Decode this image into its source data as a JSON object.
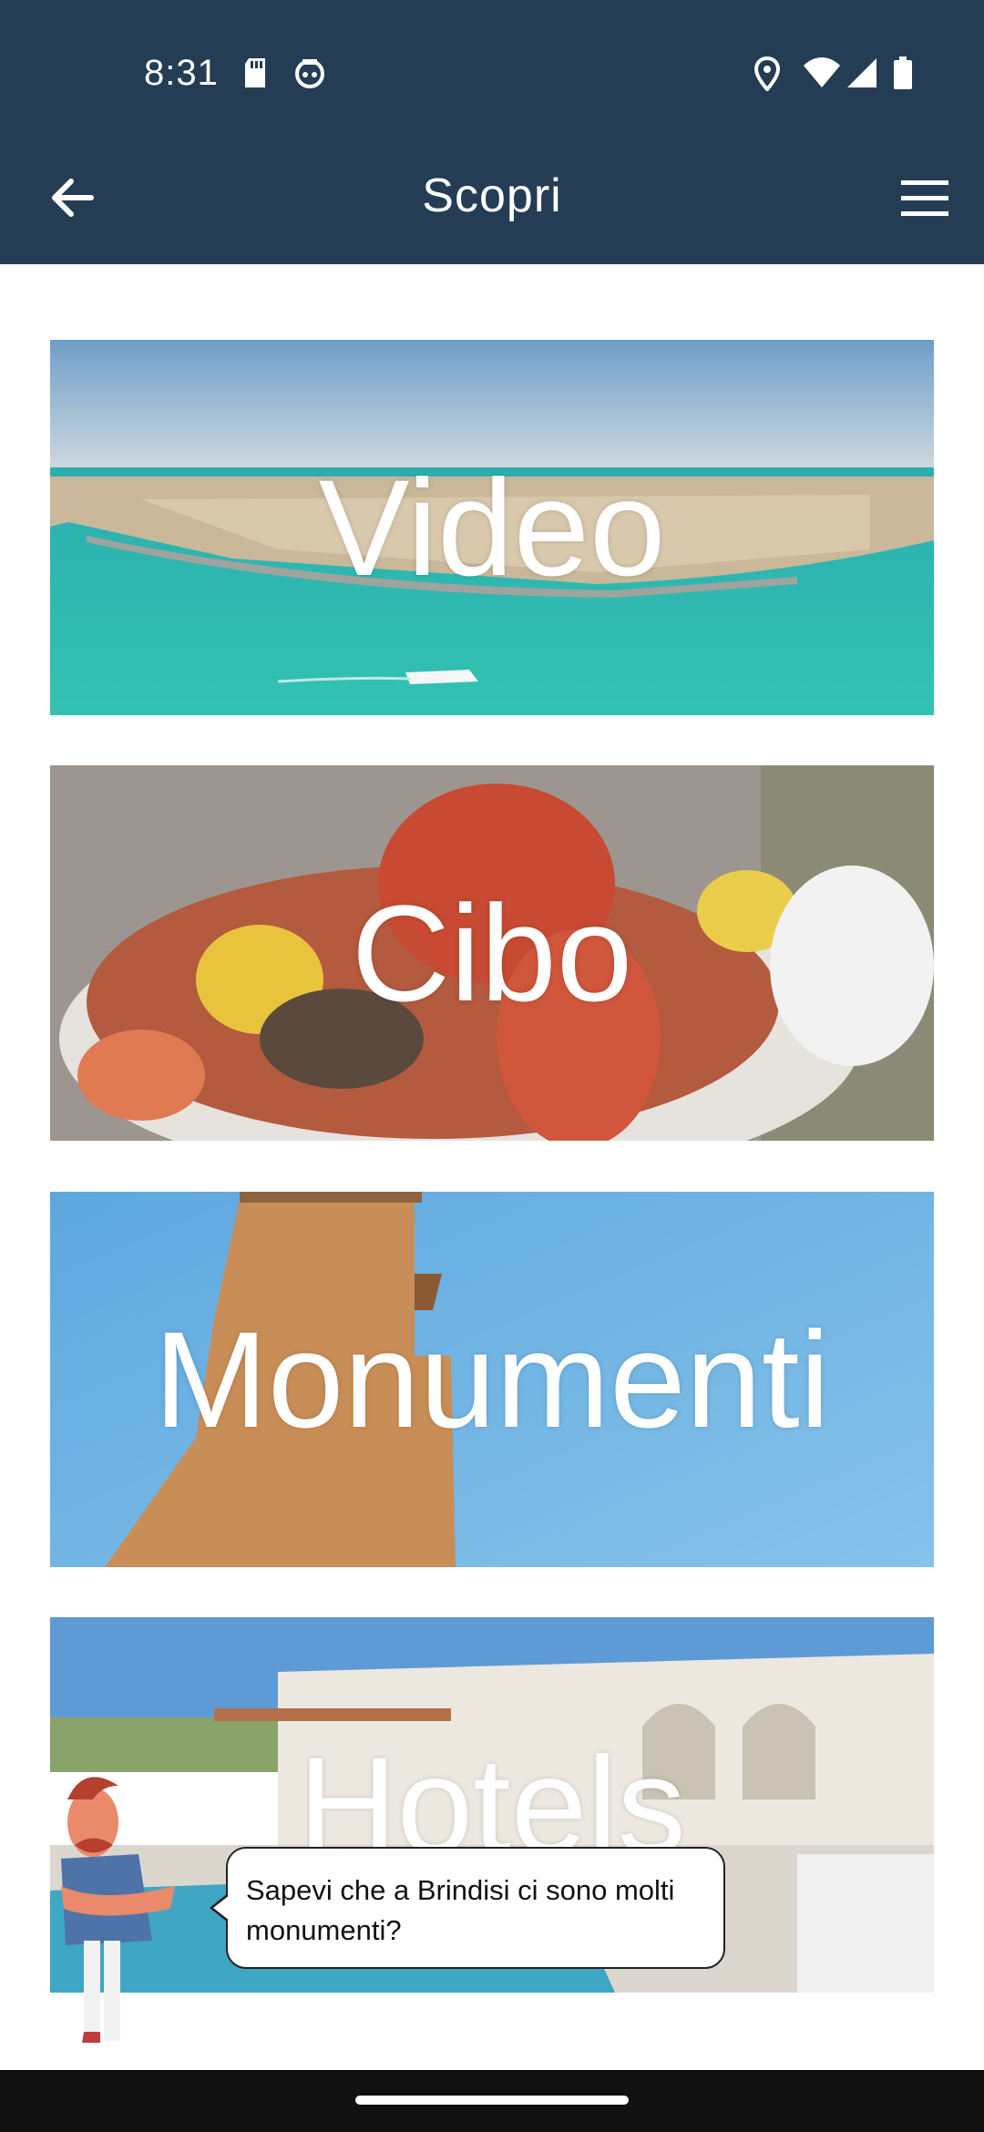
{
  "status_bar": {
    "time": "8:31",
    "left_icons": [
      "sd-card-icon",
      "robot-face-icon"
    ],
    "right_icons": [
      "location-icon",
      "wifi-icon",
      "signal-icon",
      "battery-icon"
    ]
  },
  "app_bar": {
    "title": "Scopri",
    "back_icon": "arrow-left-icon",
    "menu_icon": "hamburger-menu-icon",
    "background": "#243d55"
  },
  "cards": [
    {
      "label": "Video",
      "image": "harbor-aerial-photo"
    },
    {
      "label": "Cibo",
      "image": "seafood-platter-photo"
    },
    {
      "label": "Monumenti",
      "image": "stone-tower-photo"
    },
    {
      "label": "Hotels",
      "image": "white-masseria-hotel-pool-photo"
    }
  ],
  "tip": {
    "text": "Sapevi che a Brindisi ci sono molti monumenti?"
  }
}
